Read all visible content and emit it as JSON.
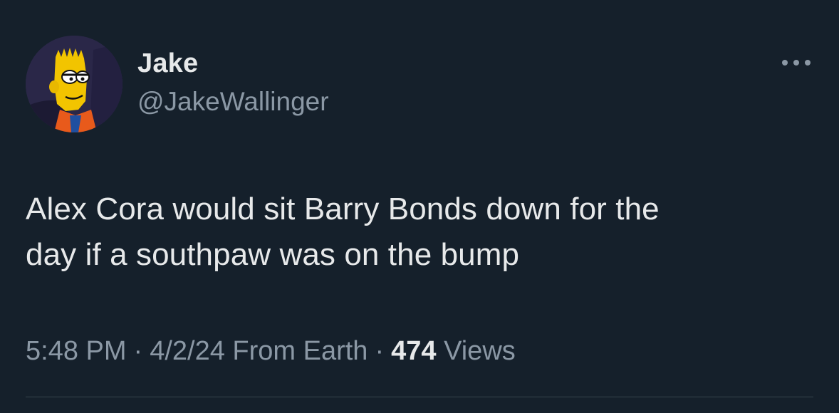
{
  "author": {
    "display_name": "Jake",
    "handle": "@JakeWallinger",
    "avatar_icon": "avatar-cartoon-icon"
  },
  "more_icon": "more-horizontal-icon",
  "tweet": {
    "text_line1": "Alex Cora would sit Barry Bonds down for the",
    "text_line2": "day if a southpaw was on the bump"
  },
  "meta": {
    "time": "5:48 PM",
    "separator": "·",
    "date": "4/2/24",
    "source": "From Earth",
    "views_count": "474",
    "views_label": "Views"
  },
  "colors": {
    "background": "#15202b",
    "primary_text": "#e7e9ea",
    "secondary_text": "#8b98a5",
    "divider": "#38444d"
  }
}
